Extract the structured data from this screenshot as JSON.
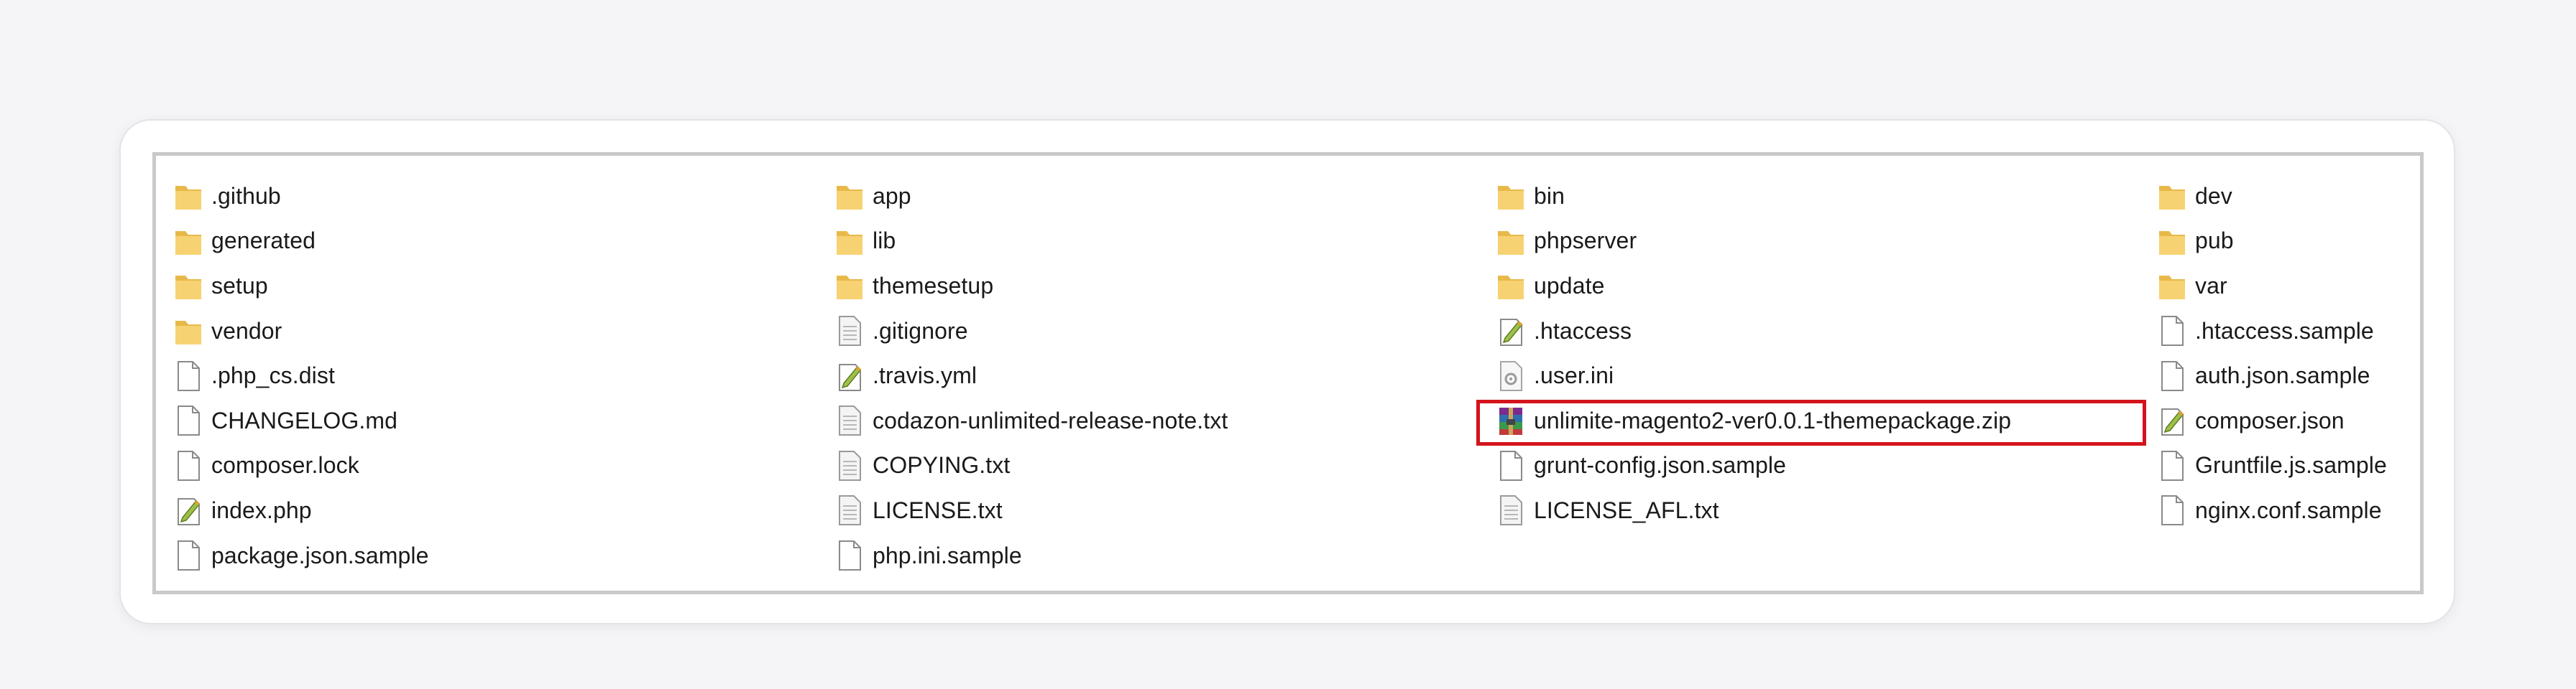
{
  "explorer": {
    "accent_highlight_color": "#d4141c",
    "columns": [
      [
        {
          "name": ".github",
          "icon": "folder-icon"
        },
        {
          "name": "generated",
          "icon": "folder-icon"
        },
        {
          "name": "setup",
          "icon": "folder-icon"
        },
        {
          "name": "vendor",
          "icon": "folder-icon"
        },
        {
          "name": ".php_cs.dist",
          "icon": "file-icon"
        },
        {
          "name": "CHANGELOG.md",
          "icon": "file-icon"
        },
        {
          "name": "composer.lock",
          "icon": "file-icon"
        },
        {
          "name": "index.php",
          "icon": "script-file-icon"
        },
        {
          "name": "package.json.sample",
          "icon": "file-icon"
        }
      ],
      [
        {
          "name": "app",
          "icon": "folder-icon"
        },
        {
          "name": "lib",
          "icon": "folder-icon"
        },
        {
          "name": "themesetup",
          "icon": "folder-icon"
        },
        {
          "name": ".gitignore",
          "icon": "text-file-icon"
        },
        {
          "name": ".travis.yml",
          "icon": "script-file-icon"
        },
        {
          "name": "codazon-unlimited-release-note.txt",
          "icon": "text-file-icon"
        },
        {
          "name": "COPYING.txt",
          "icon": "text-file-icon"
        },
        {
          "name": "LICENSE.txt",
          "icon": "text-file-icon"
        },
        {
          "name": "php.ini.sample",
          "icon": "file-icon"
        }
      ],
      [
        {
          "name": "bin",
          "icon": "folder-icon"
        },
        {
          "name": "phpserver",
          "icon": "folder-icon"
        },
        {
          "name": "update",
          "icon": "folder-icon"
        },
        {
          "name": ".htaccess",
          "icon": "script-file-icon"
        },
        {
          "name": ".user.ini",
          "icon": "settings-file-icon"
        },
        {
          "name": "unlimite-magento2-ver0.0.1-themepackage.zip",
          "icon": "archive-icon",
          "highlighted": true
        },
        {
          "name": "grunt-config.json.sample",
          "icon": "file-icon"
        },
        {
          "name": "LICENSE_AFL.txt",
          "icon": "text-file-icon"
        }
      ],
      [
        {
          "name": "dev",
          "icon": "folder-icon"
        },
        {
          "name": "pub",
          "icon": "folder-icon"
        },
        {
          "name": "var",
          "icon": "folder-icon"
        },
        {
          "name": ".htaccess.sample",
          "icon": "file-icon"
        },
        {
          "name": "auth.json.sample",
          "icon": "file-icon"
        },
        {
          "name": "composer.json",
          "icon": "script-file-icon"
        },
        {
          "name": "Gruntfile.js.sample",
          "icon": "file-icon"
        },
        {
          "name": "nginx.conf.sample",
          "icon": "file-icon"
        }
      ]
    ]
  }
}
